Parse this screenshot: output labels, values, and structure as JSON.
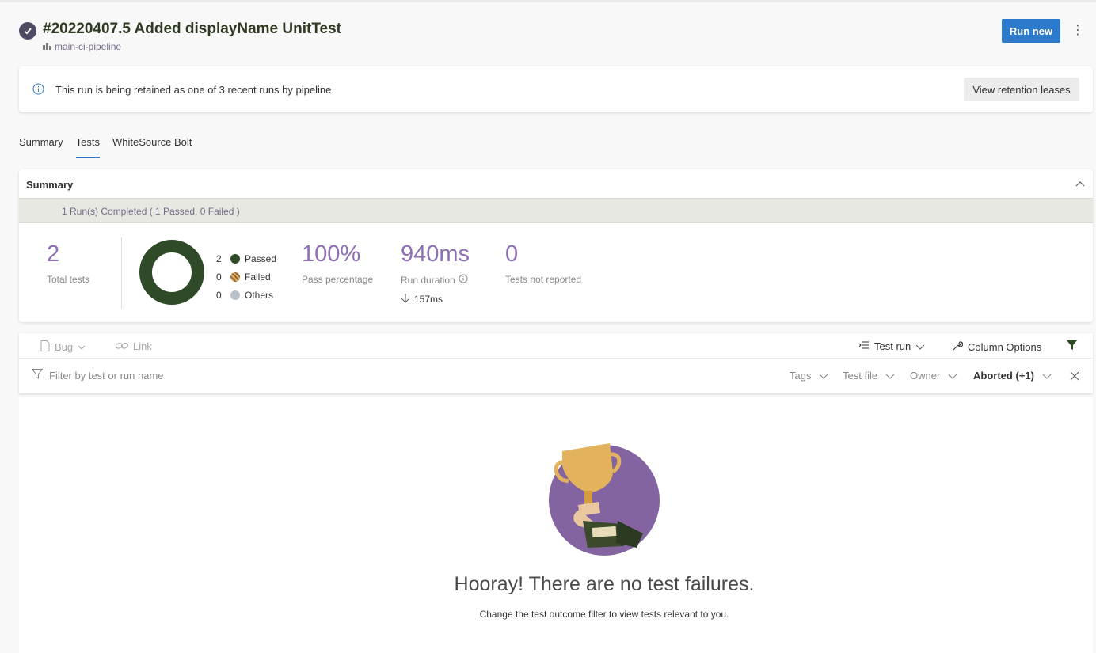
{
  "header": {
    "title": "#20220407.5 Added displayName UnitTest",
    "pipeline": "main-ci-pipeline",
    "run_new_label": "Run new",
    "more_label": "⋮"
  },
  "banner": {
    "text": "This run is being retained as one of 3 recent runs by pipeline.",
    "button_label": "View retention leases"
  },
  "tabs": [
    "Summary",
    "Tests",
    "WhiteSource Bolt"
  ],
  "active_tab": "Tests",
  "summary": {
    "title": "Summary",
    "run_status": "1 Run(s) Completed ( 1 Passed, 0 Failed )",
    "total_tests": {
      "value": "2",
      "label": "Total tests"
    },
    "chart_data": {
      "type": "pie",
      "categories": [
        "Passed",
        "Failed",
        "Others"
      ],
      "values": [
        2,
        0,
        0
      ]
    },
    "legend": [
      {
        "count": "2",
        "label": "Passed",
        "color": "#2e4a26"
      },
      {
        "count": "0",
        "label": "Failed",
        "color": "#9a6a2a"
      },
      {
        "count": "0",
        "label": "Others",
        "color": "#b9c2c8"
      }
    ],
    "pass_percentage": {
      "value": "100%",
      "label": "Pass percentage"
    },
    "run_duration": {
      "value": "940ms",
      "label": "Run duration",
      "delta": "157ms"
    },
    "not_reported": {
      "value": "0",
      "label": "Tests not reported"
    }
  },
  "toolbar": {
    "bug_label": "Bug",
    "link_label": "Link",
    "test_run_label": "Test run",
    "column_options_label": "Column Options"
  },
  "filters": {
    "search_placeholder": "Filter by test or run name",
    "tags": "Tags",
    "test_file": "Test file",
    "owner": "Owner",
    "outcome": "Aborted (+1)"
  },
  "empty_state": {
    "headline": "Hooray! There are no test failures.",
    "hint": "Change the test outcome filter to view tests relevant to you."
  },
  "colors": {
    "accent": "#2b7acb",
    "metric": "#8e6fb5",
    "passed": "#2e4a26"
  }
}
